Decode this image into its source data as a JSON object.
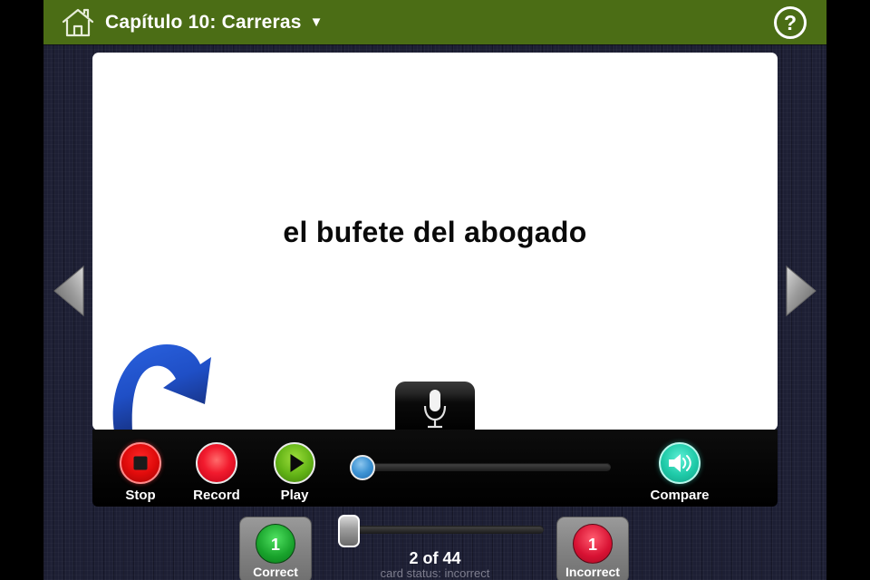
{
  "header": {
    "home_icon": "home-icon",
    "title": "Capítulo 10: Carreras",
    "caret": "▼",
    "help_label": "?",
    "bg_color": "#4b6d15"
  },
  "card": {
    "text": "el bufete del abogado",
    "bg_color": "#ffffff"
  },
  "annotation": {
    "arrow_icon": "curved-arrow-icon",
    "color": "#1e50c8"
  },
  "navigation": {
    "prev_icon": "triangle-left-icon",
    "next_icon": "triangle-right-icon"
  },
  "recorder": {
    "mic_icon": "microphone-icon"
  },
  "toolbar": {
    "stop_label": "Stop",
    "record_label": "Record",
    "play_label": "Play",
    "compare_label": "Compare",
    "compare_icon": "speaker-icon",
    "volume": {
      "value": 0,
      "thumb_color": "#3f94d4"
    }
  },
  "footer": {
    "correct_label": "Correct",
    "correct_count": "1",
    "correct_color": "#19a32c",
    "incorrect_label": "Incorrect",
    "incorrect_count": "1",
    "incorrect_color": "#d81233",
    "counter": "2 of 44",
    "card_status": "card status: incorrect",
    "progress": {
      "current": 2,
      "total": 44
    }
  }
}
